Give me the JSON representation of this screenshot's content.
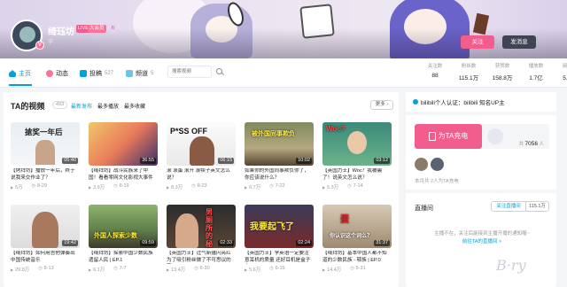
{
  "header": {
    "username": "绮珏坊",
    "tag_live": "LIVE",
    "tag_vip": "大会员",
    "tag_level": "6",
    "avatar_badge": "V",
    "sign": "字",
    "follow_btn": "关注",
    "message_btn": "发消息"
  },
  "nav": {
    "home": "主页",
    "dynamic": "动态",
    "posts": "投稿",
    "posts_count": "527",
    "channels": "频道",
    "channels_count": "5",
    "search_placeholder": "搜索视频"
  },
  "stats": [
    {
      "label": "关注数",
      "value": "88"
    },
    {
      "label": "粉丝数",
      "value": "115.1万"
    },
    {
      "label": "获赞数",
      "value": "158.8万"
    },
    {
      "label": "播放数",
      "value": "1.7亿"
    },
    {
      "label": "阅读数",
      "value": "5.7万"
    }
  ],
  "videos_section": {
    "title": "TA的视频",
    "count": "493",
    "sort_latest": "最新发布",
    "sort_most_played": "最多播放",
    "sort_most_fav": "最多收藏",
    "more": "更多"
  },
  "videos": [
    {
      "caption": "搶奖一年后",
      "duration": "05:40",
      "title": "【烤拜坊】播放一年后，终于说我来交作业了？",
      "views": "5万",
      "date": "8-29"
    },
    {
      "caption": "",
      "duration": "36:55",
      "title": "【绮拜坊】战斗民族来了中国！看看零网文化影视大事件",
      "views": "3.9万",
      "date": "8-19"
    },
    {
      "caption": "P*SS OFF",
      "duration": "06:15",
      "title": "滚 滚蛋 滚开 滚犊子英文怎么说？",
      "views": "8.3万",
      "date": "8-23"
    },
    {
      "caption": "被外国同事欺负",
      "duration": "10:02",
      "title": "如果你的外国同事欺负你了，你应该说什么？",
      "views": "6.7万",
      "date": "7-22"
    },
    {
      "caption": "Woc?",
      "duration": "03:12",
      "title": "【英国力士】Woc？我被骗了！说英文怎么说？",
      "views": "5.3万",
      "date": "7-14"
    },
    {
      "caption": "",
      "duration": "19:42",
      "title": "【绮拜坊】如何用吉他弹奏出中国传统音乐",
      "views": "29.8万",
      "date": "8-13"
    },
    {
      "caption": "外国人探索少数",
      "duration": "09:59",
      "title": "【绮拜坊】探索中国少数民族遗留人民 | EP.1",
      "views": "6.1万",
      "date": "7-7"
    },
    {
      "caption": "男厕所的秘密",
      "duration": "02:33",
      "title": "【英国力士】过气新疆闪亮红为了吸引粉丝做了不可思议的事",
      "views": "13.4万",
      "date": "6-30"
    },
    {
      "caption": "我要起飞了",
      "duration": "02:24",
      "title": "【英国力士】学英语一定要注意耳机的质量 还好耳机是盒子中",
      "views": "5.6万",
      "date": "6-15"
    },
    {
      "caption": "蛋",
      "caption2": "你认识这个词么？",
      "duration": "31:37",
      "title": "【绮拜坊】基本中国人都不知道的少数民族 - 鄂族 | EP.0",
      "views": "14.4万",
      "date": "5-31"
    }
  ],
  "notice": {
    "text": "bilibili个人认证：bilibili 知名UP主"
  },
  "charge": {
    "button": "为TA充电",
    "count": "7056",
    "count_unit": "人",
    "note": "本月共 2人为TA充电"
  },
  "live": {
    "title": "直播间",
    "follow_btn": "关注直播间",
    "follow_count": "115.1万",
    "message": "主播不在，关注后能接到主播开播的通知喔~",
    "link": "前往TA的直播间 >"
  }
}
